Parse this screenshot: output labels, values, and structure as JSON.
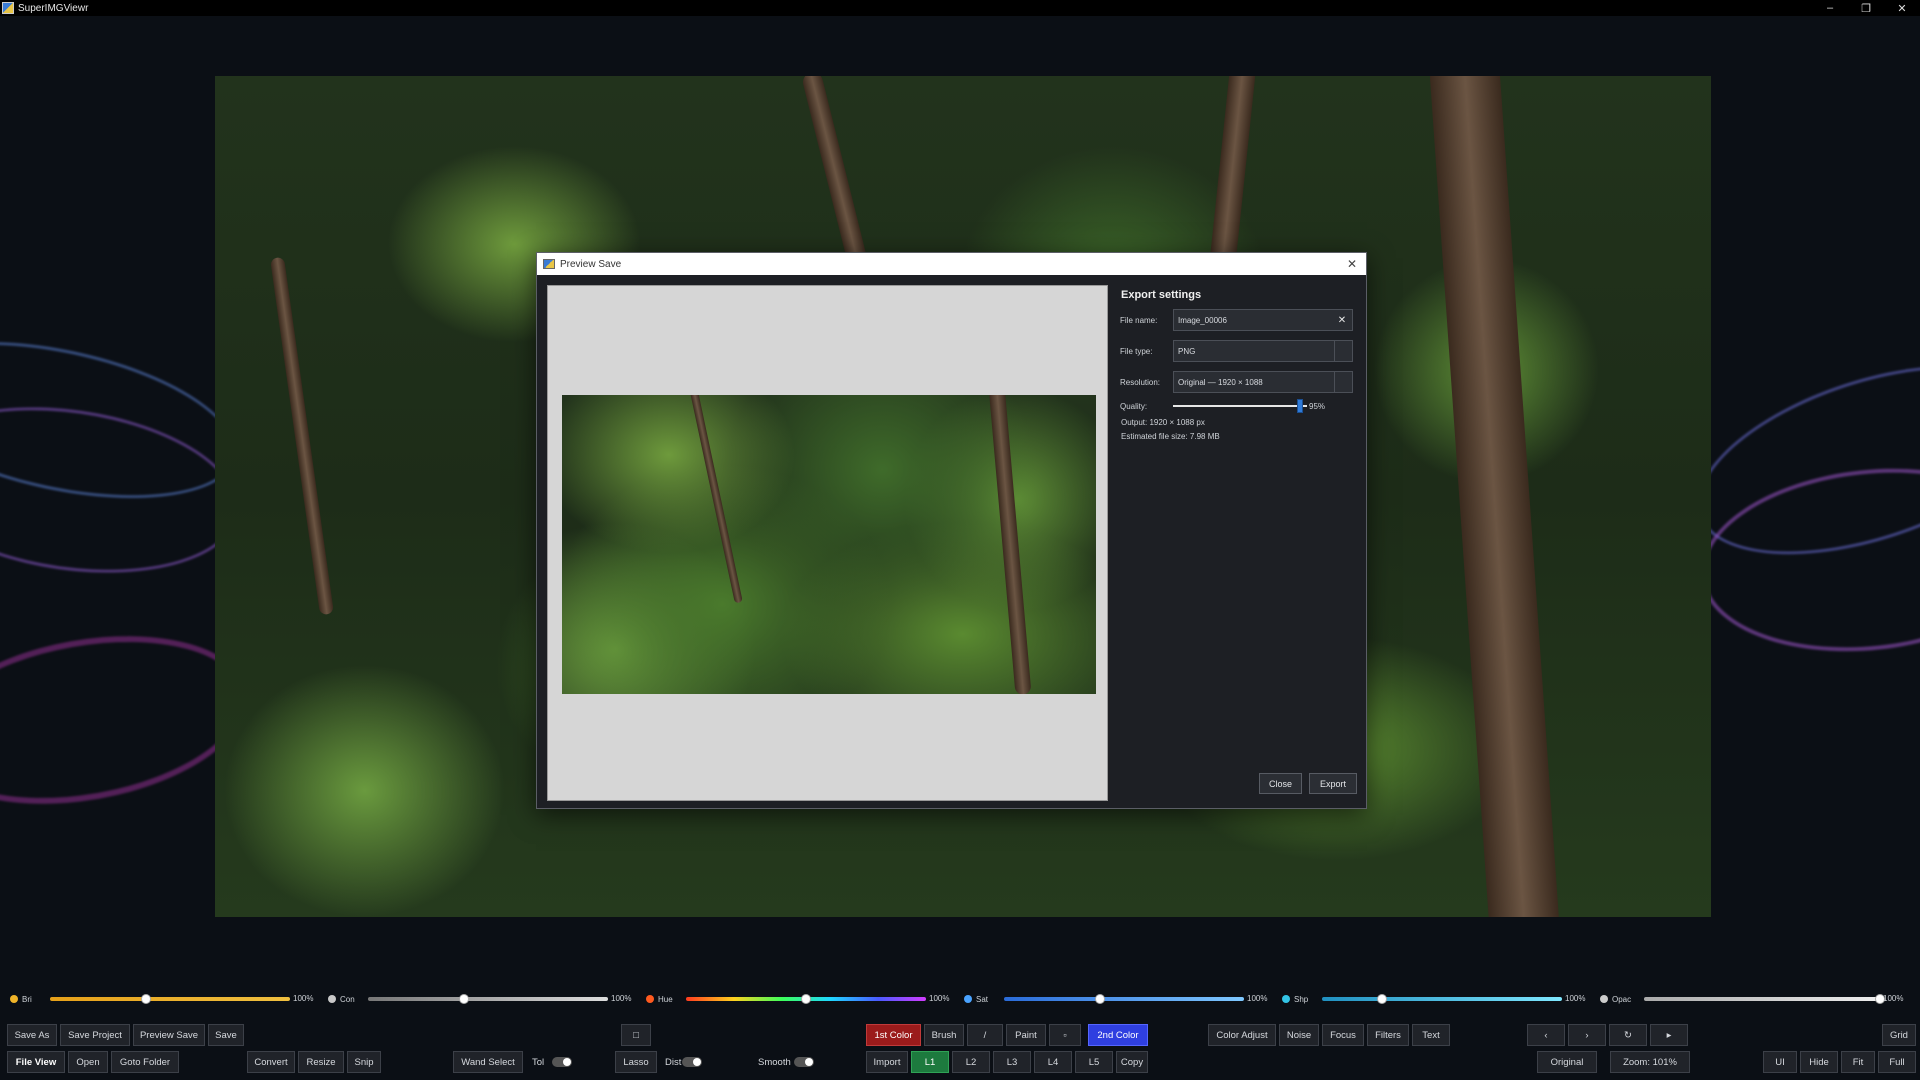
{
  "app": {
    "title": "SuperIMGViewr"
  },
  "window_controls": {
    "minimize": "–",
    "restore": "❐",
    "close": "✕"
  },
  "dialog": {
    "title": "Preview Save",
    "close_glyph": "✕",
    "settings_title": "Export settings",
    "file_name_label": "File name:",
    "file_name_value": "Image_00006",
    "clear_glyph": "✕",
    "file_type_label": "File type:",
    "file_type_value": "PNG",
    "resolution_label": "Resolution:",
    "resolution_value": "Original — 1920 × 1088",
    "quality_label": "Quality:",
    "quality_value": "95%",
    "quality_fraction": 0.95,
    "output_text": "Output: 1920 × 1088 px",
    "size_text": "Estimated file size: 7.98 MB",
    "close_button": "Close",
    "export_button": "Export"
  },
  "adjustments": [
    {
      "label": "Bri",
      "value": "100%",
      "icon": "sun-icon",
      "level": 0.4,
      "color": "#f0b429"
    },
    {
      "label": "Con",
      "value": "100%",
      "icon": "contrast-icon",
      "level": 0.4,
      "color": "#c8c8c8"
    },
    {
      "label": "Hue",
      "value": "100%",
      "icon": "hue-icon",
      "level": 0.5,
      "color": "#ff5a1f"
    },
    {
      "label": "Sat",
      "value": "100%",
      "icon": "saturation-icon",
      "level": 0.4,
      "color": "#4aa3ff"
    },
    {
      "label": "Shp",
      "value": "100%",
      "icon": "sharpness-icon",
      "level": 0.25,
      "color": "#33c4e6"
    },
    {
      "label": "Opac",
      "value": "100%",
      "icon": "opacity-icon",
      "level": 1.0,
      "color": "#cccccc"
    }
  ],
  "toolbar_row1": {
    "save_as": "Save As",
    "save_project": "Save Project",
    "preview_save": "Preview Save",
    "save": "Save",
    "rect_tool": "□",
    "first_color": "1st Color",
    "brush": "Brush",
    "line": "/",
    "paint": "Paint",
    "eraser": "▫",
    "second_color": "2nd Color",
    "color_adjust": "Color Adjust",
    "noise": "Noise",
    "focus": "Focus",
    "filters": "Filters",
    "text": "Text",
    "prev": "‹",
    "next": "›",
    "rotate": "↻",
    "play": "▸",
    "grid": "Grid"
  },
  "toolbar_row2": {
    "file_view": "File View",
    "open": "Open",
    "goto_folder": "Goto Folder",
    "convert": "Convert",
    "resize": "Resize",
    "snip": "Snip",
    "wand_select": "Wand Select",
    "tol": "Tol",
    "lasso": "Lasso",
    "dist": "Dist",
    "smooth": "Smooth",
    "import": "Import",
    "l1": "L1",
    "l2": "L2",
    "l3": "L3",
    "l4": "L4",
    "l5": "L5",
    "copy": "Copy",
    "original": "Original",
    "zoom": "Zoom: 101%",
    "ui": "UI",
    "hide": "Hide",
    "fit": "Fit",
    "full": "Full"
  }
}
